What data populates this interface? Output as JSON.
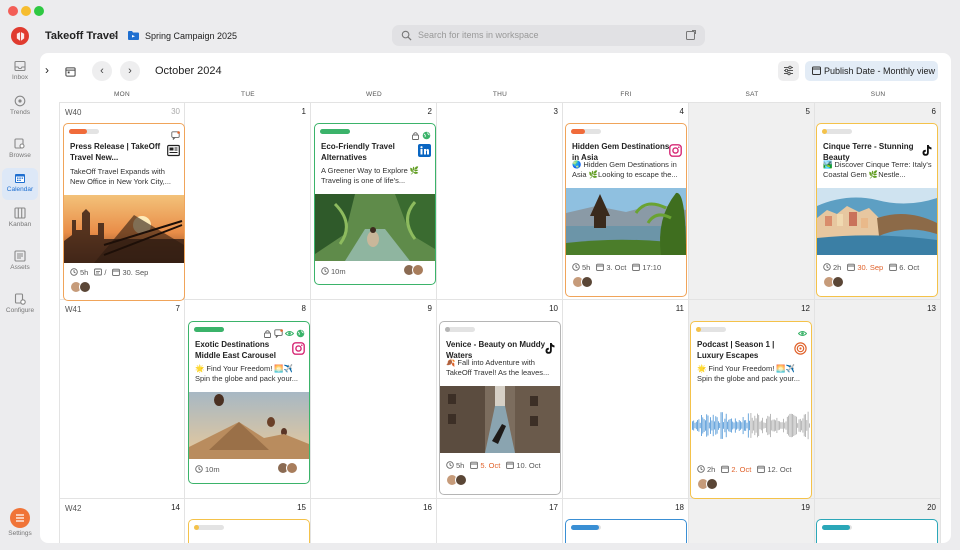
{
  "app": {
    "workspace": "Takeoff Travel",
    "campaign": "Spring Campaign 2025",
    "search_placeholder": "Search for items in workspace"
  },
  "nav": [
    {
      "label": "Inbox",
      "icon": "inbox-icon"
    },
    {
      "label": "Trends",
      "icon": "trends-icon"
    },
    {
      "label": "Browse",
      "icon": "browse-icon"
    },
    {
      "label": "Calendar",
      "icon": "calendar-icon",
      "active": true
    },
    {
      "label": "Kanban",
      "icon": "kanban-icon"
    },
    {
      "label": "Assets",
      "icon": "assets-icon"
    },
    {
      "label": "Configure",
      "icon": "configure-icon"
    }
  ],
  "settings_label": "Settings",
  "toolbar": {
    "month": "October 2024",
    "view": "Publish Date - Monthly view"
  },
  "weekdays": [
    "MON",
    "TUE",
    "WED",
    "THU",
    "FRI",
    "SAT",
    "SUN"
  ],
  "weeks": [
    {
      "label": "W40",
      "dates": [
        "30",
        "1",
        "2",
        "3",
        "4",
        "5",
        "6"
      ]
    },
    {
      "label": "W41",
      "dates": [
        "7",
        "8",
        "9",
        "10",
        "11",
        "12",
        "13"
      ]
    },
    {
      "label": "W42",
      "dates": [
        "14",
        "15",
        "16",
        "17",
        "18",
        "19",
        "20"
      ]
    }
  ],
  "colors": {
    "orange": "#f0a45a",
    "green": "#3bb36a",
    "grey": "#b5b5b5",
    "yellow": "#f4c24a",
    "blue": "#3a8fd4",
    "teal": "#2ba7b8"
  },
  "cards": [
    {
      "title": "Press Release | TakeOff Travel New...",
      "text": "TakeOff Travel Expands with New Office in New York City,...",
      "channel": "news-icon",
      "meta": [
        {
          "icon": "clock-icon",
          "text": "5h"
        },
        {
          "icon": "doc-icon",
          "text": "/"
        },
        {
          "icon": "calendar-icon",
          "text": "30. Sep"
        }
      ]
    },
    {
      "title": "Eco-Friendly Travel Alternatives",
      "text": "A Greener Way to Explore 🌿 Traveling is one of life's...",
      "channel": "linkedin-icon",
      "meta": [
        {
          "icon": "clock-icon",
          "text": "10m"
        }
      ]
    },
    {
      "title": "Hidden Gem Destinations in Asia",
      "text": "🌏 Hidden Gem Destinations in Asia 🌿Looking to escape the...",
      "channel": "instagram-icon",
      "meta": [
        {
          "icon": "clock-icon",
          "text": "5h"
        },
        {
          "icon": "calendar-icon",
          "text": "3. Oct"
        },
        {
          "icon": "calendar-icon",
          "text": "17:10"
        }
      ]
    },
    {
      "title": "Cinque Terre - Stunning Beauty",
      "text": "🏞️ Discover Cinque Terre: Italy's Coastal Gem 🌿Nestle...",
      "channel": "tiktok-icon",
      "meta": [
        {
          "icon": "clock-icon",
          "text": "2h"
        },
        {
          "icon": "calendar-icon",
          "text": "30. Sep",
          "hot": true
        },
        {
          "icon": "calendar-icon",
          "text": "6. Oct"
        }
      ]
    },
    {
      "title": "Exotic Destinations Middle East Carousel",
      "text": "🌟 Find Your Freedom! 🌅✈️ Spin the globe and pack your...",
      "channel": "instagram-icon",
      "meta": [
        {
          "icon": "clock-icon",
          "text": "10m"
        }
      ]
    },
    {
      "title": "Venice - Beauty on Muddy Waters",
      "text": "🍂 Fall into Adventure with TakeOff Travel! As the leaves...",
      "channel": "tiktok-icon",
      "meta": [
        {
          "icon": "clock-icon",
          "text": "5h"
        },
        {
          "icon": "calendar-icon",
          "text": "5. Oct",
          "hot": true
        },
        {
          "icon": "calendar-icon",
          "text": "10. Oct"
        }
      ]
    },
    {
      "title": "Podcast | Season 1 | Luxury Escapes",
      "text": "🌟 Find Your Freedom! 🌅✈️ Spin the globe and pack your...",
      "channel": "podcast-icon",
      "meta": [
        {
          "icon": "clock-icon",
          "text": "2h"
        },
        {
          "icon": "calendar-icon",
          "text": "2. Oct",
          "hot": true
        },
        {
          "icon": "calendar-icon",
          "text": "12. Oct"
        }
      ]
    }
  ]
}
